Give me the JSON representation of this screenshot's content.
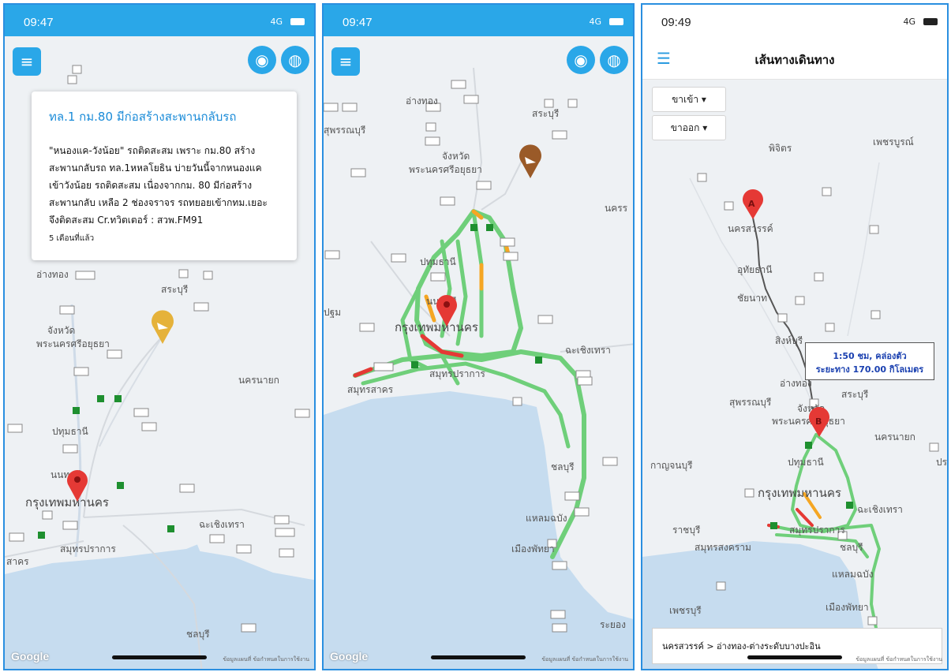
{
  "screens": [
    {
      "status": {
        "time": "09:47",
        "network": "4G"
      },
      "popup": {
        "title": "ทล.1 กม.80 มีก่อสร้างสะพานกลับรถ",
        "lines": [
          "\"หนองแค-วังน้อย\" รถติดสะสม เพราะ กม.80 สร้าง",
          "สะพานกลับรถ ทล.1หหลโยธิน บ่ายวันนี้จากหนองแค",
          "เข้าวังน้อย รถติดสะสม เนื่องจากกม. 80 มีก่อสร้าง",
          "สะพานกลับ เหลือ 2 ช่องจราจร รถทยอยเข้ากทม.เยอะ",
          "จึงติดสะสม Cr.ทวิตเตอร์ : สวพ.FM91"
        ],
        "time_ago": "5 เดือนที่แล้ว"
      },
      "map_labels": [
        "อ่างทอง",
        "สระบุรี",
        "จังหวัด",
        "พระนครศรีอยุธยา",
        "ปทุมธานี",
        "นนทบุรี",
        "กรุงเทพมหานคร",
        "สมุทรปราการ",
        "ฉะเชิงเทรา",
        "นครนายก",
        "ชลบุรี",
        "สาคร"
      ],
      "google": "Google",
      "terms": "ข้อมูลแผนที่   ข้อกำหนดในการใช้งาน"
    },
    {
      "status": {
        "time": "09:47",
        "network": "4G"
      },
      "map_labels": [
        "อ่างทอง",
        "สระบุรี",
        "สุพรรณบุรี",
        "จังหวัด",
        "พระนครศรีอยุธยา",
        "ปทุมธานี",
        "นนทบุรี",
        "กรุงเทพมหานคร",
        "สมุทรปราการ",
        "ฉะเชิงเทรา",
        "สมุทรสาคร",
        "ชลบุรี",
        "เมืองพัทยา",
        "แหลมฉบัง",
        "นครร",
        "ปฐม",
        "ระยอง"
      ],
      "google": "Google",
      "terms": "ข้อมูลแผนที่   ข้อกำหนดในการใช้งาน"
    },
    {
      "status": {
        "time": "09:49",
        "network": "4G"
      },
      "header": {
        "title": "เส้นทางเดินทาง"
      },
      "dropdowns": [
        "ขาเข้า ▾",
        "ขาออก ▾"
      ],
      "markers": [
        "A",
        "B"
      ],
      "route_tip": {
        "line1": "1:50 ชม, คล่องตัว",
        "line2": "ระยะทาง 170.00 กิโลเมตร"
      },
      "map_labels": [
        "พิจิตร",
        "เพชรบูรณ์",
        "นครสวรรค์",
        "อุทัยธานี",
        "ชัยนาท",
        "สิงห์บุรี",
        "อ่างทอง",
        "สุพรรณบุรี",
        "สระบุรี",
        "จังหวัด",
        "พระนครศรีอยุธยา",
        "นครนายก",
        "กาญจนบุรี",
        "ปทุมธานี",
        "กรุงเทพมหานคร",
        "ฉะเชิงเทรา",
        "ราชบุรี",
        "สมุทรปราการ",
        "สมุทรสงคราม",
        "ชลบุรี",
        "เพชรบุรี",
        "เมืองพัทยา",
        "แหลมฉบัง",
        "ปร"
      ],
      "route_summary": "นครสวรรค์ > อ่างทอง-ต่างระดับบางปะอิน",
      "terms": "ข้อมูลแผนที่   ข้อกำหนดในการใช้งาน"
    }
  ],
  "colors": {
    "accent": "#2aa7e8",
    "sea": "#c6dcef",
    "land": "#eef1f4",
    "traffic_green": "#6fcf7a",
    "traffic_red": "#e53935",
    "traffic_orange": "#f5a623"
  }
}
